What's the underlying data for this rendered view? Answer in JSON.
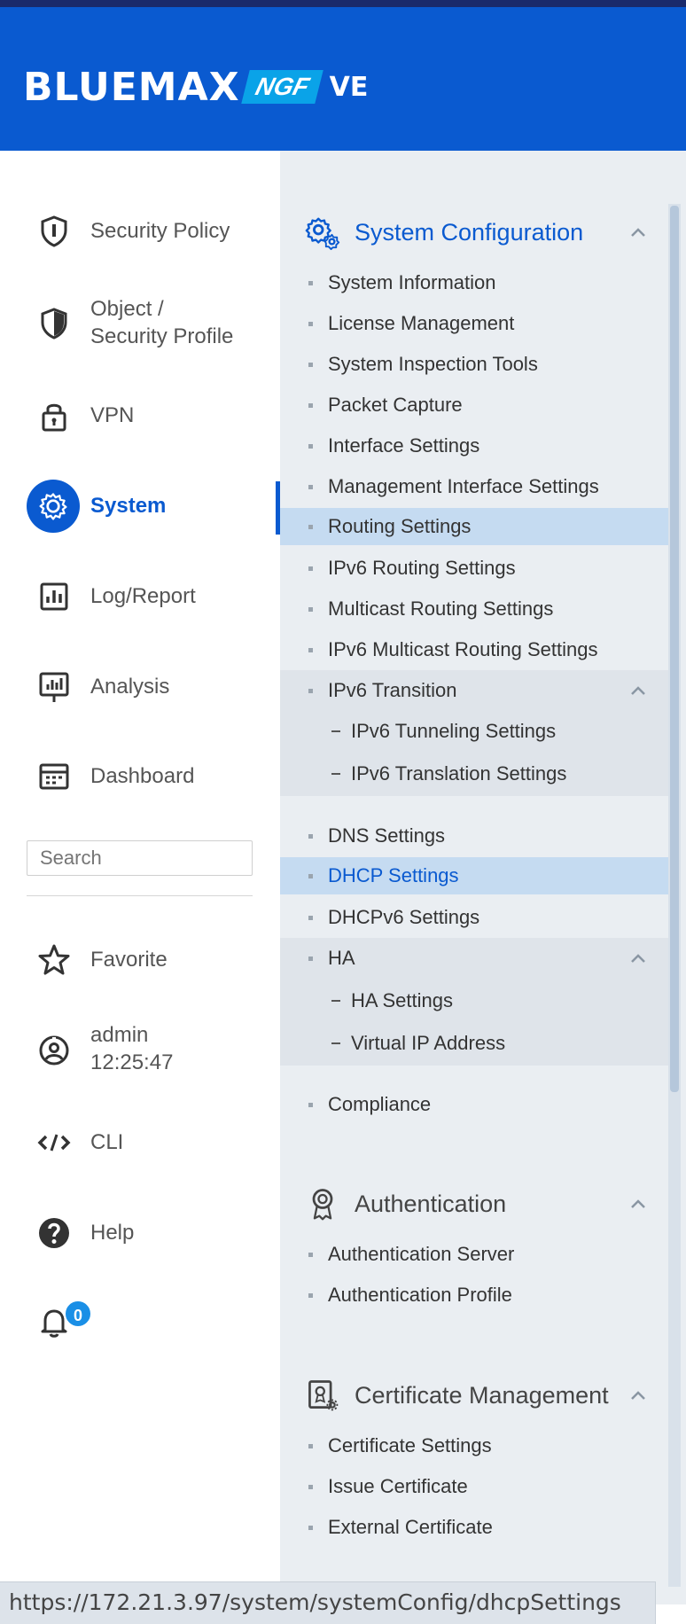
{
  "brand": {
    "name": "BLUEMAX",
    "product": "NGF",
    "edition": "VE"
  },
  "nav": {
    "security_policy": "Security Policy",
    "object_line1": "Object /",
    "object_line2": "Security Profile",
    "vpn": "VPN",
    "system": "System",
    "log_report": "Log/Report",
    "analysis": "Analysis",
    "dashboard": "Dashboard",
    "search_placeholder": "Search",
    "favorite": "Favorite",
    "user": "admin",
    "time": "12:25:47",
    "cli": "CLI",
    "help": "Help",
    "notifications_count": "0"
  },
  "system_config": {
    "title": "System Configuration",
    "items": [
      "System Information",
      "License Management",
      "System Inspection Tools",
      "Packet Capture",
      "Interface Settings",
      "Management Interface Settings",
      "Routing Settings",
      "IPv6 Routing Settings",
      "Multicast Routing Settings",
      "IPv6 Multicast Routing Settings"
    ],
    "ipv6_transition": {
      "label": "IPv6 Transition",
      "children": [
        "IPv6 Tunneling Settings",
        "IPv6 Translation Settings"
      ]
    },
    "items2": [
      "DNS Settings",
      "DHCP Settings",
      "DHCPv6 Settings"
    ],
    "ha": {
      "label": "HA",
      "children": [
        "HA Settings",
        "Virtual IP Address"
      ]
    },
    "compliance": "Compliance"
  },
  "authentication": {
    "title": "Authentication",
    "items": [
      "Authentication Server",
      "Authentication Profile"
    ]
  },
  "certificate": {
    "title": "Certificate Management",
    "items": [
      "Certificate Settings",
      "Issue Certificate",
      "External Certificate"
    ]
  },
  "status_url": "https://172.21.3.97/system/systemConfig/dhcpSettings",
  "colors": {
    "brand": "#0a5ad0",
    "highlight": "#c5dbf1",
    "panel": "#eaeef2"
  }
}
